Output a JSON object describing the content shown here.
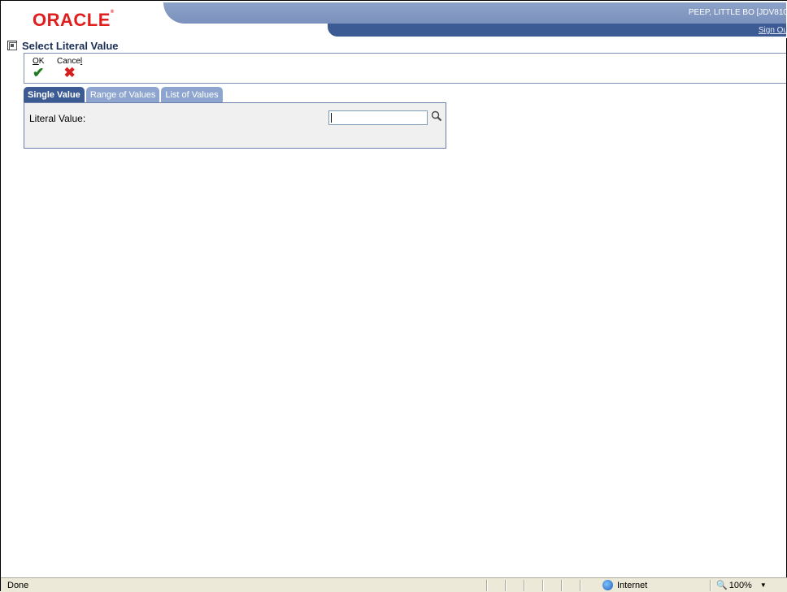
{
  "header": {
    "logo_text": "ORACLE",
    "user": "PEEP, LITTLE BO  [JDV810",
    "sign_out": "Sign Ou"
  },
  "page": {
    "title": "Select Literal Value"
  },
  "toolbar": {
    "ok_label": "OK",
    "cancel_label": "Cancel"
  },
  "tabs": [
    {
      "label": "Single Value",
      "active": true
    },
    {
      "label": "Range of Values",
      "active": false
    },
    {
      "label": "List of Values",
      "active": false
    }
  ],
  "form": {
    "literal_label": "Literal Value:",
    "literal_value": "",
    "search_icon": "magnifier-icon"
  },
  "status": {
    "text": "Done",
    "zone": "Internet",
    "zoom": "100%"
  },
  "colors": {
    "brand_red": "#e01e1e",
    "header_dark": "#3c5a94",
    "tab_active": "#3d5b93",
    "tab_inactive": "#8ea6cf"
  }
}
